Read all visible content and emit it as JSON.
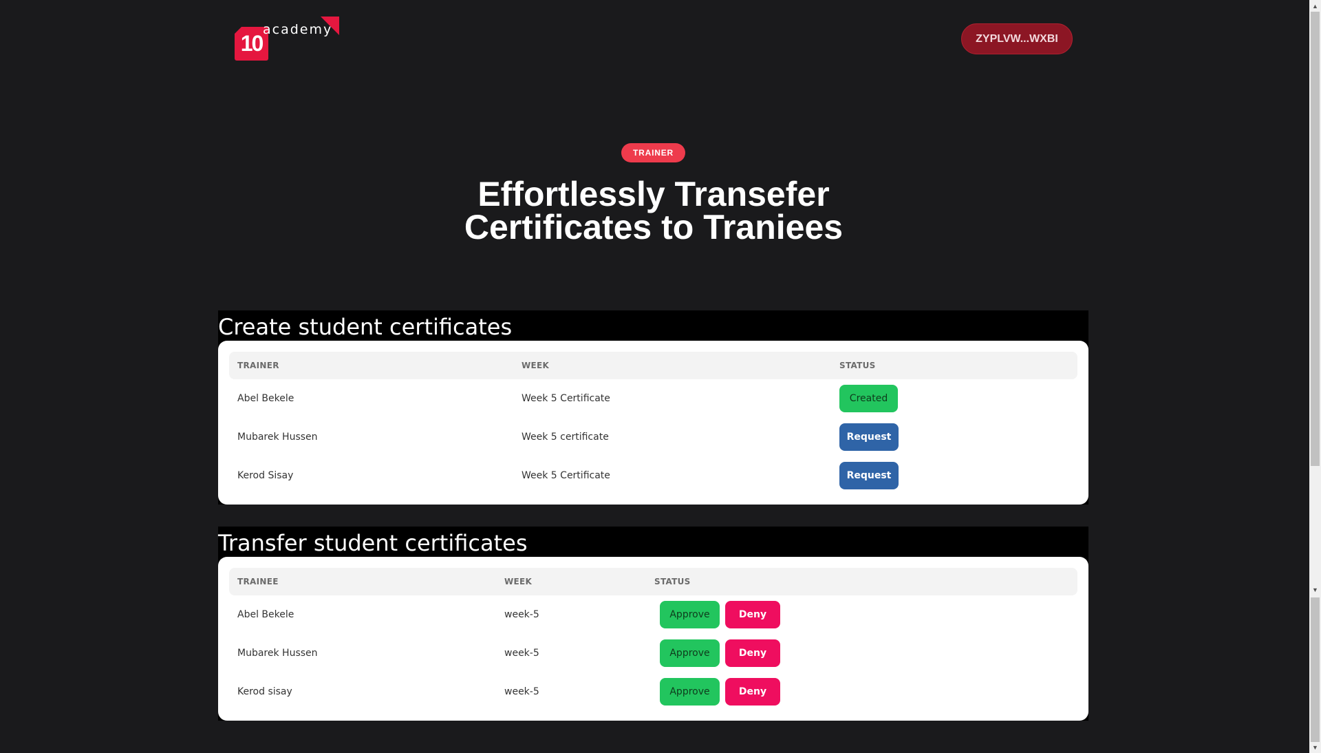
{
  "header": {
    "logo_number": "10",
    "logo_text": "academy",
    "wallet_label": "ZYPLVW...WXBI"
  },
  "hero": {
    "badge": "TRAINER",
    "title": "Effortlessly Transefer Certificates to Traniees"
  },
  "create_section": {
    "title": "Create student certificates",
    "columns": [
      "TRAINER",
      "WEEK",
      "STATUS"
    ],
    "rows": [
      {
        "name": "Abel Bekele",
        "week": "Week 5 Certificate",
        "status": "Created"
      },
      {
        "name": "Mubarek Hussen",
        "week": "Week 5 certificate",
        "status": "Request"
      },
      {
        "name": "Kerod Sisay",
        "week": "Week 5 Certificate",
        "status": "Request"
      }
    ]
  },
  "transfer_section": {
    "title": "Transfer student certificates",
    "columns": [
      "TRAINEE",
      "WEEK",
      "STATUS"
    ],
    "approve_label": "Approve",
    "deny_label": "Deny",
    "rows": [
      {
        "name": "Abel Bekele",
        "week": "week-5"
      },
      {
        "name": "Mubarek Hussen",
        "week": "week-5"
      },
      {
        "name": "Kerod sisay",
        "week": "week-5"
      }
    ]
  },
  "colors": {
    "background": "#1a1a1c",
    "brand_red": "#e5173f",
    "created_green": "#22c55e",
    "request_blue": "#2f64a7",
    "deny_pink": "#ef0e5f"
  }
}
